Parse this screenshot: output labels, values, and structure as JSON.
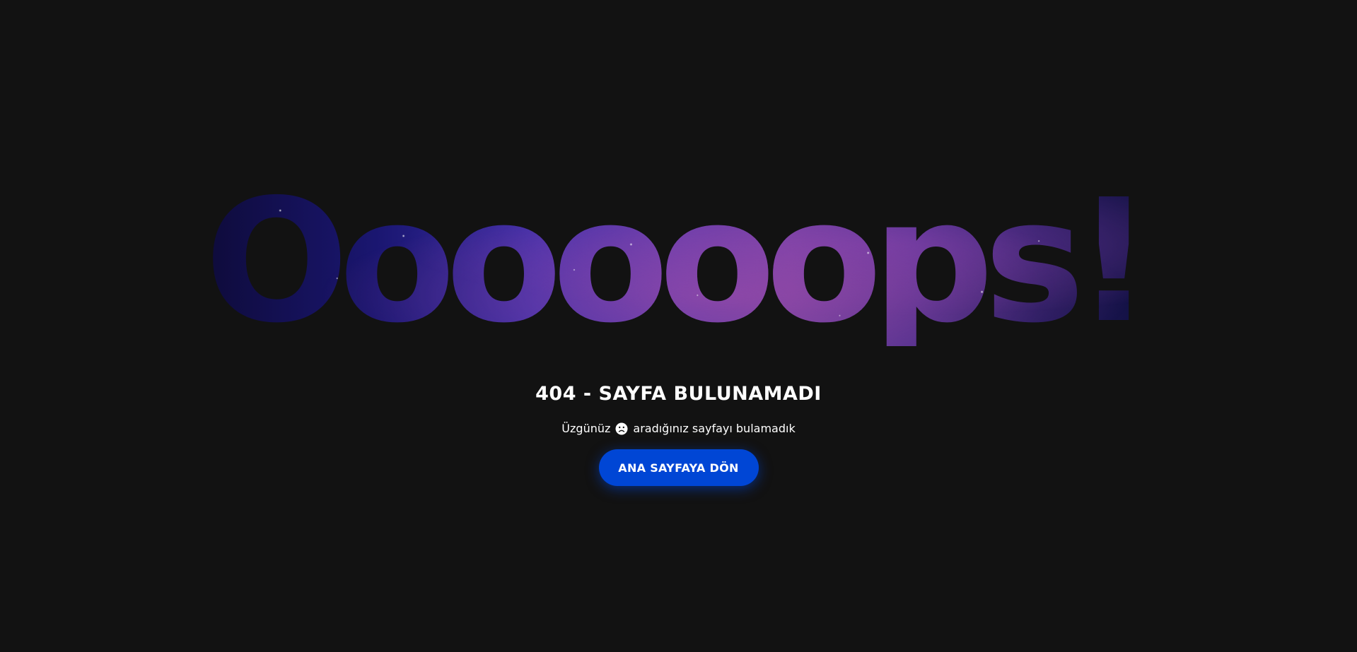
{
  "hero": {
    "headline": "Oooooops!"
  },
  "error": {
    "title": "404 - SAYFA BULUNAMADI",
    "message_before_icon": "Üzgünüz",
    "icon": "sad-face-icon",
    "message_after_icon": "aradığınız sayfayı bulamadık"
  },
  "actions": {
    "home_button_label": "ANA SAYFAYA DÖN"
  },
  "colors": {
    "background": "#121212",
    "button": "#0046d5",
    "text": "#ffffff"
  }
}
